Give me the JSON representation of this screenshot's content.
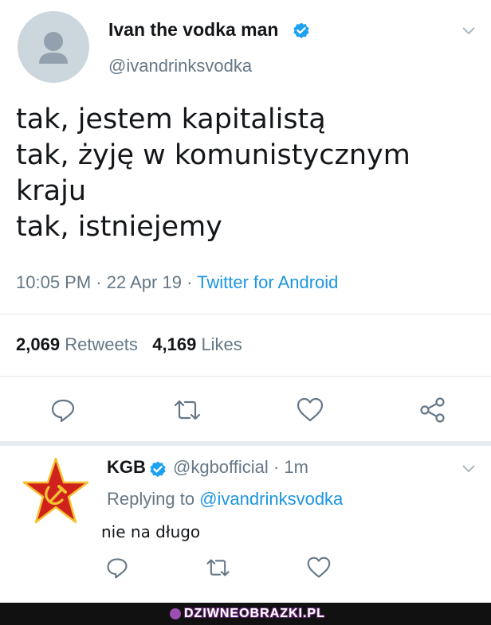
{
  "tweet": {
    "display_name": "Ivan the vodka man",
    "handle": "@ivandrinksvodka",
    "lines": [
      "tak, jestem kapitalistą",
      "tak, żyję w komunistycznym",
      "kraju",
      "tak, istniejemy"
    ],
    "time": "10:05 PM",
    "date": "22 Apr 19",
    "source": "Twitter for Android",
    "retweets_count": "2,069",
    "retweets_label": "Retweets",
    "likes_count": "4,169",
    "likes_label": "Likes",
    "icons": [
      "reply-icon",
      "retweet-icon",
      "like-icon",
      "share-icon"
    ]
  },
  "reply": {
    "display_name": "KGB",
    "handle": "@kgbofficial",
    "age": "1m",
    "replying_prefix": "Replying to",
    "replying_to": "@ivandrinksvodka",
    "text": "nie na długo",
    "icons": [
      "reply-icon",
      "retweet-icon",
      "like-icon"
    ]
  },
  "watermark": {
    "text": "DZIWNEOBRAZKI.PL"
  },
  "colors": {
    "verified": "#1da1f2",
    "link": "#1b95e0",
    "secondary_text": "#657786",
    "star_red": "#d0221c",
    "star_gold": "#f2c230"
  }
}
